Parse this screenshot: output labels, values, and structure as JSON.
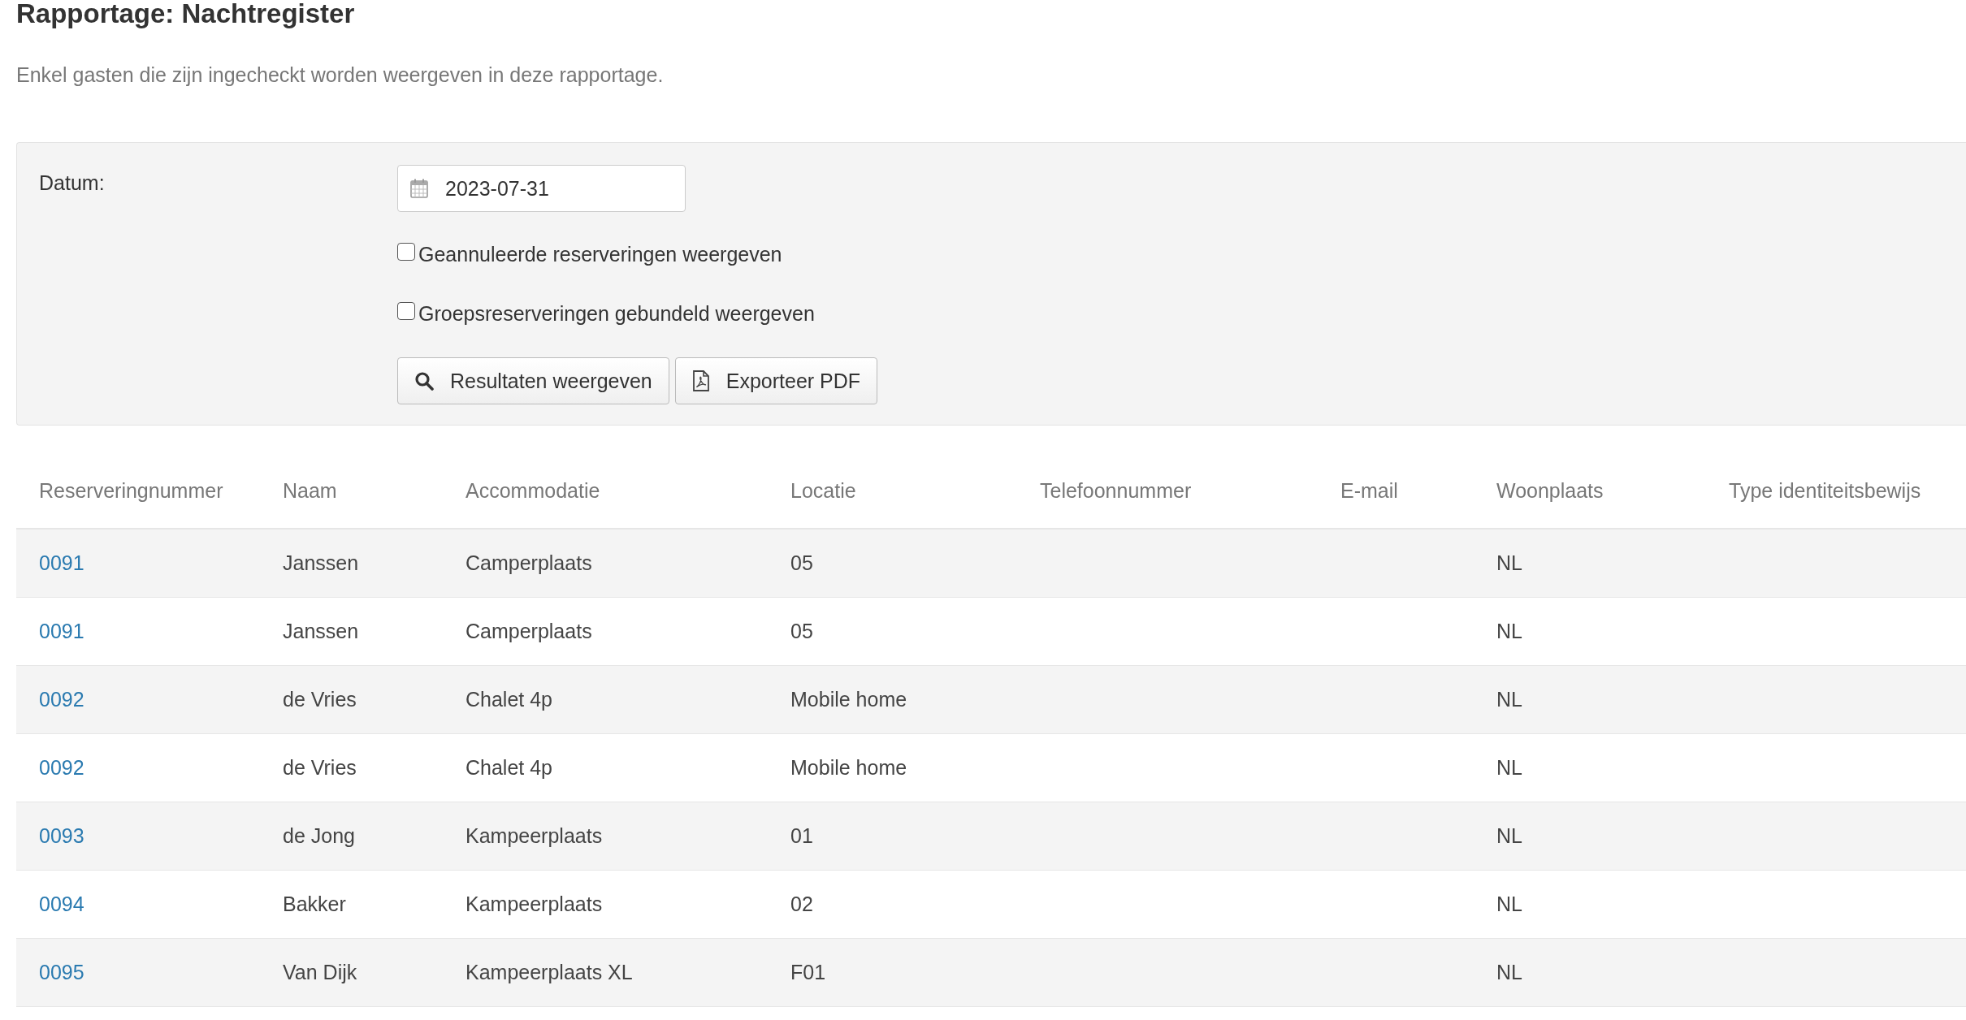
{
  "title": "Rapportage: Nachtregister",
  "description": "Enkel gasten die zijn ingecheckt worden weergeven in deze rapportage.",
  "filter": {
    "date_label": "Datum:",
    "date_value": "2023-07-31",
    "checkboxes": [
      {
        "label": "Geannuleerde reserveringen weergeven",
        "checked": false
      },
      {
        "label": "Groepsreserveringen gebundeld weergeven",
        "checked": false
      }
    ],
    "buttons": [
      {
        "label": "Resultaten weergeven",
        "kind": "search"
      },
      {
        "label": "Exporteer PDF",
        "kind": "pdf"
      }
    ]
  },
  "table": {
    "columns": [
      "Reserveringnummer",
      "Naam",
      "Accommodatie",
      "Locatie",
      "Telefoonnummer",
      "E-mail",
      "Woonplaats",
      "Type identiteitsbewijs"
    ],
    "rows": [
      [
        "0091",
        "Janssen",
        "Camperplaats",
        "05",
        "",
        "",
        "NL",
        ""
      ],
      [
        "0091",
        "Janssen",
        "Camperplaats",
        "05",
        "",
        "",
        "NL",
        ""
      ],
      [
        "0092",
        "de Vries",
        "Chalet 4p",
        "Mobile home",
        "",
        "",
        "NL",
        ""
      ],
      [
        "0092",
        "de Vries",
        "Chalet 4p",
        "Mobile home",
        "",
        "",
        "NL",
        ""
      ],
      [
        "0093",
        "de Jong",
        "Kampeerplaats",
        "01",
        "",
        "",
        "NL",
        ""
      ],
      [
        "0094",
        "Bakker",
        "Kampeerplaats",
        "02",
        "",
        "",
        "NL",
        ""
      ],
      [
        "0095",
        "Van Dijk",
        "Kampeerplaats XL",
        "F01",
        "",
        "",
        "NL",
        ""
      ]
    ]
  }
}
